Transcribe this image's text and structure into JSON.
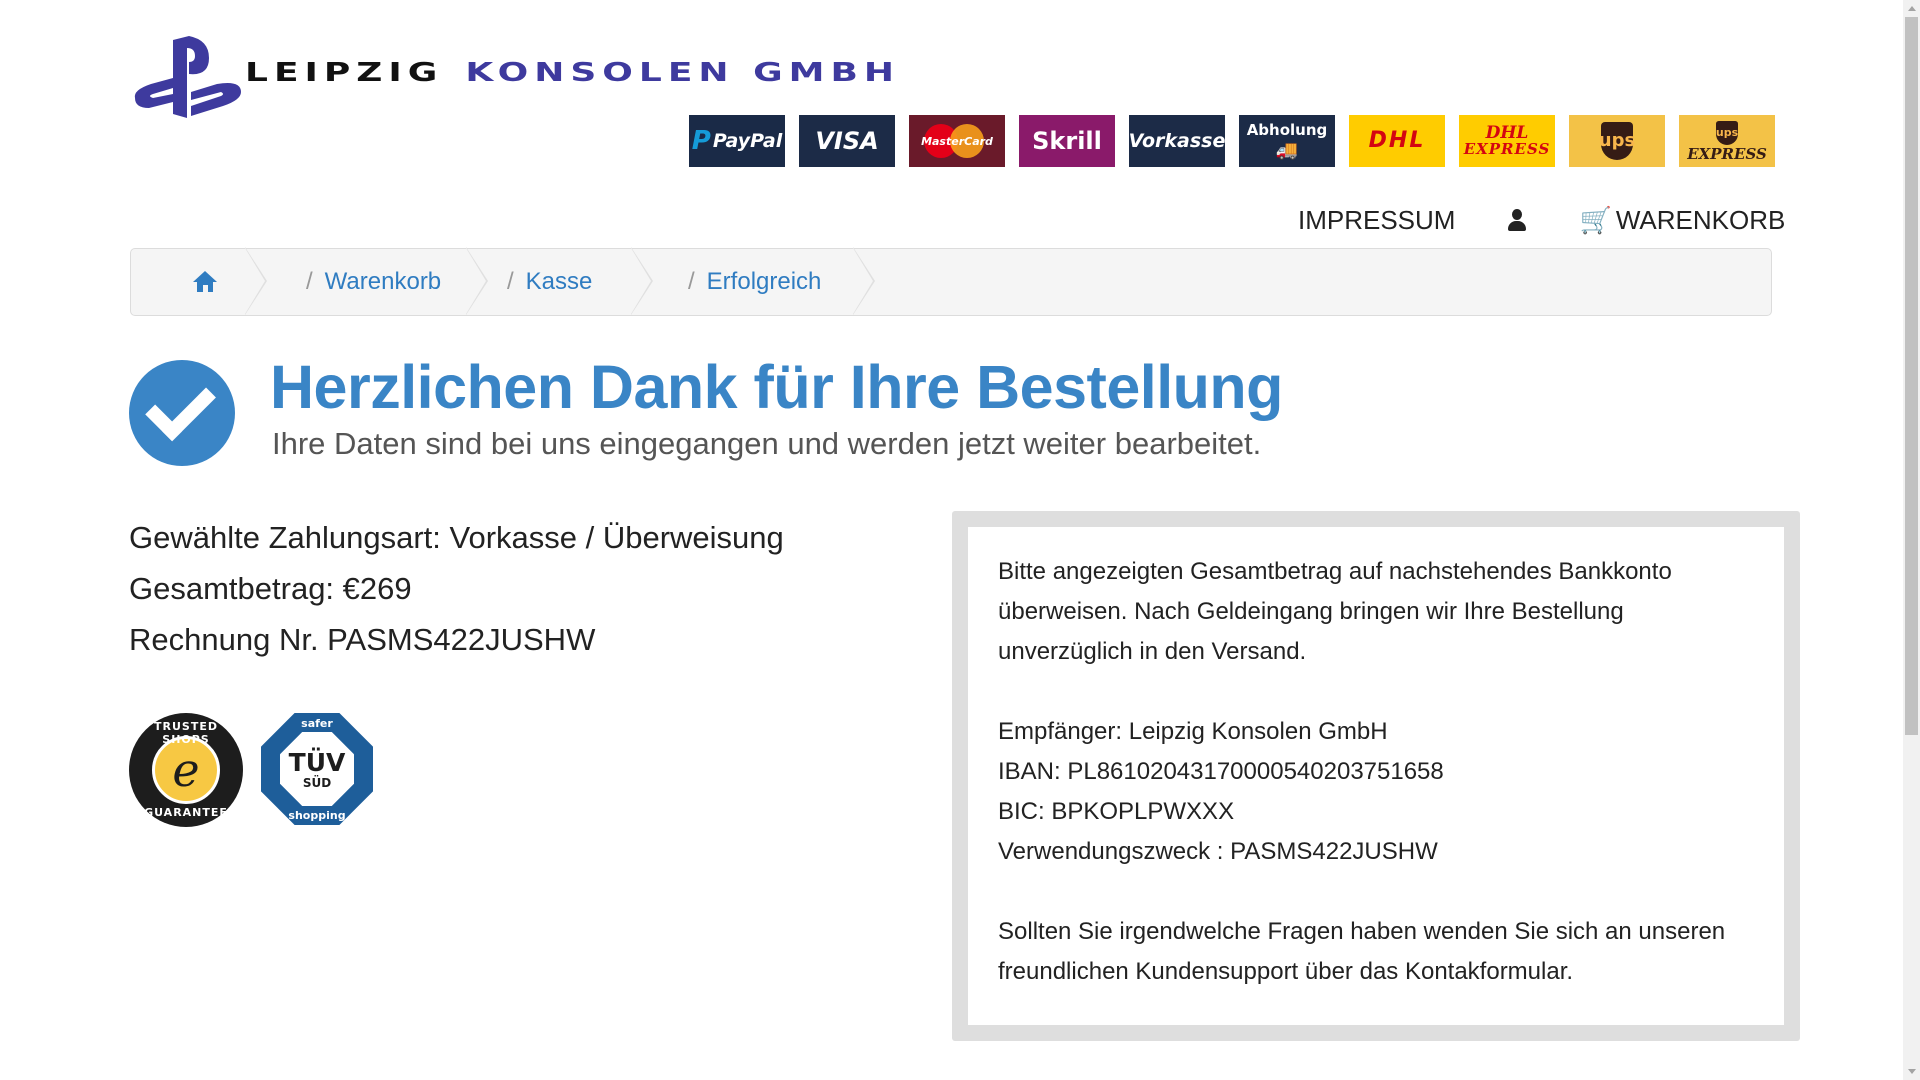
{
  "brand": {
    "name_part1": "LEIPZIG",
    "name_part2": "KONSOLEN GMBH"
  },
  "payments": [
    {
      "id": "paypal",
      "label": "PayPal"
    },
    {
      "id": "visa",
      "label": "VISA"
    },
    {
      "id": "mastercard",
      "label": "MasterCard"
    },
    {
      "id": "skrill",
      "label": "Skrill"
    },
    {
      "id": "vorkasse",
      "label": "Vorkasse"
    },
    {
      "id": "abholung",
      "label": "Abholung"
    },
    {
      "id": "dhl",
      "label": "DHL"
    },
    {
      "id": "dhl-express",
      "label": "DHL",
      "sub": "EXPRESS"
    },
    {
      "id": "ups",
      "label": "ups"
    },
    {
      "id": "ups-express",
      "label": "ups",
      "sub": "EXPRESS"
    }
  ],
  "nav": {
    "impressum": "IMPRESSUM",
    "cart": "WARENKORB"
  },
  "breadcrumb": {
    "items": [
      "Warenkorb",
      "Kasse",
      "Erfolgreich"
    ],
    "separator": "/"
  },
  "success": {
    "title": "Herzlichen Dank für Ihre Bestellung",
    "subtitle": "Ihre Daten sind bei uns eingegangen und werden jetzt weiter bearbeitet."
  },
  "order": {
    "payment_method": "Gewählte Zahlungsart: Vorkasse / Überweisung",
    "total": "Gesamtbetrag: €269",
    "invoice": "Rechnung Nr. PASMS422JUSHW"
  },
  "seals": {
    "trusted_shops_top": "TRUSTED SHOPS",
    "trusted_shops_letter": "e",
    "trusted_shops_bottom": "GUARANTEE",
    "tuv_top": "safer",
    "tuv_main": "TÜV",
    "tuv_sub": "SÜD",
    "tuv_bottom": "shopping"
  },
  "bank": {
    "intro_1": "Bitte angezeigten Gesamtbetrag auf nachstehendes Bankkonto",
    "intro_2": "überweisen. Nach Geldeingang bringen wir Ihre Bestellung",
    "intro_3": "unverzüglich in den Versand.",
    "recipient": "Empfänger: Leipzig Konsolen GmbH",
    "iban": "IBAN: PL86102043170000540203751658",
    "bic": "BIC: BPKOPLPWXXX",
    "reference": "Verwendungszweck : PASMS422JUSHW",
    "support_1": "Sollten Sie irgendwelche Fragen haben wenden Sie sich an unseren",
    "support_2": "freundlichen Kundensupport über das Kontakformular."
  },
  "colors": {
    "accent": "#3a85c6",
    "link": "#2f7cc1",
    "logo_purple": "#3e3a9e"
  }
}
